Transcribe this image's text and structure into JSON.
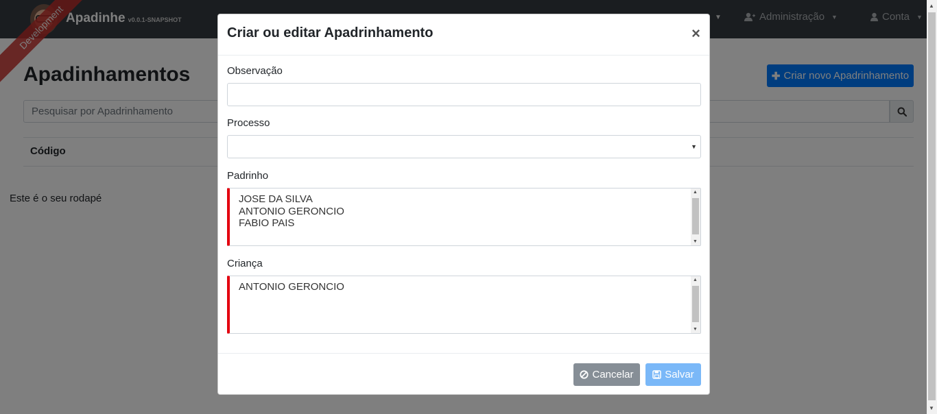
{
  "navbar": {
    "brand_name": "Apadinhe",
    "brand_version": "v0.0.1-SNAPSHOT",
    "ribbon": "Development",
    "admin_label": "Administração",
    "account_label": "Conta"
  },
  "page": {
    "title": "Apadinhamentos",
    "create_button": "Criar novo Apadrinhamento",
    "search_placeholder": "Pesquisar por Apadrinhamento",
    "table_header_code": "Código",
    "footer": "Este é o seu rodapé"
  },
  "modal": {
    "title": "Criar ou editar Apadrinhamento",
    "close": "×",
    "observacao_label": "Observação",
    "observacao_value": "",
    "processo_label": "Processo",
    "processo_value": "",
    "padrinho_label": "Padrinho",
    "padrinho_options": [
      "JOSE DA SILVA",
      "ANTONIO GERONCIO",
      "FABIO PAIS"
    ],
    "crianca_label": "Criança",
    "crianca_options": [
      "ANTONIO GERONCIO"
    ],
    "cancel_button": "Cancelar",
    "save_button": "Salvar"
  },
  "colors": {
    "navbar": "#343a40",
    "primary": "#007bff",
    "invalid_border": "#e3000f",
    "cancel": "#868e96",
    "save_disabled": "#7ab8f8"
  }
}
